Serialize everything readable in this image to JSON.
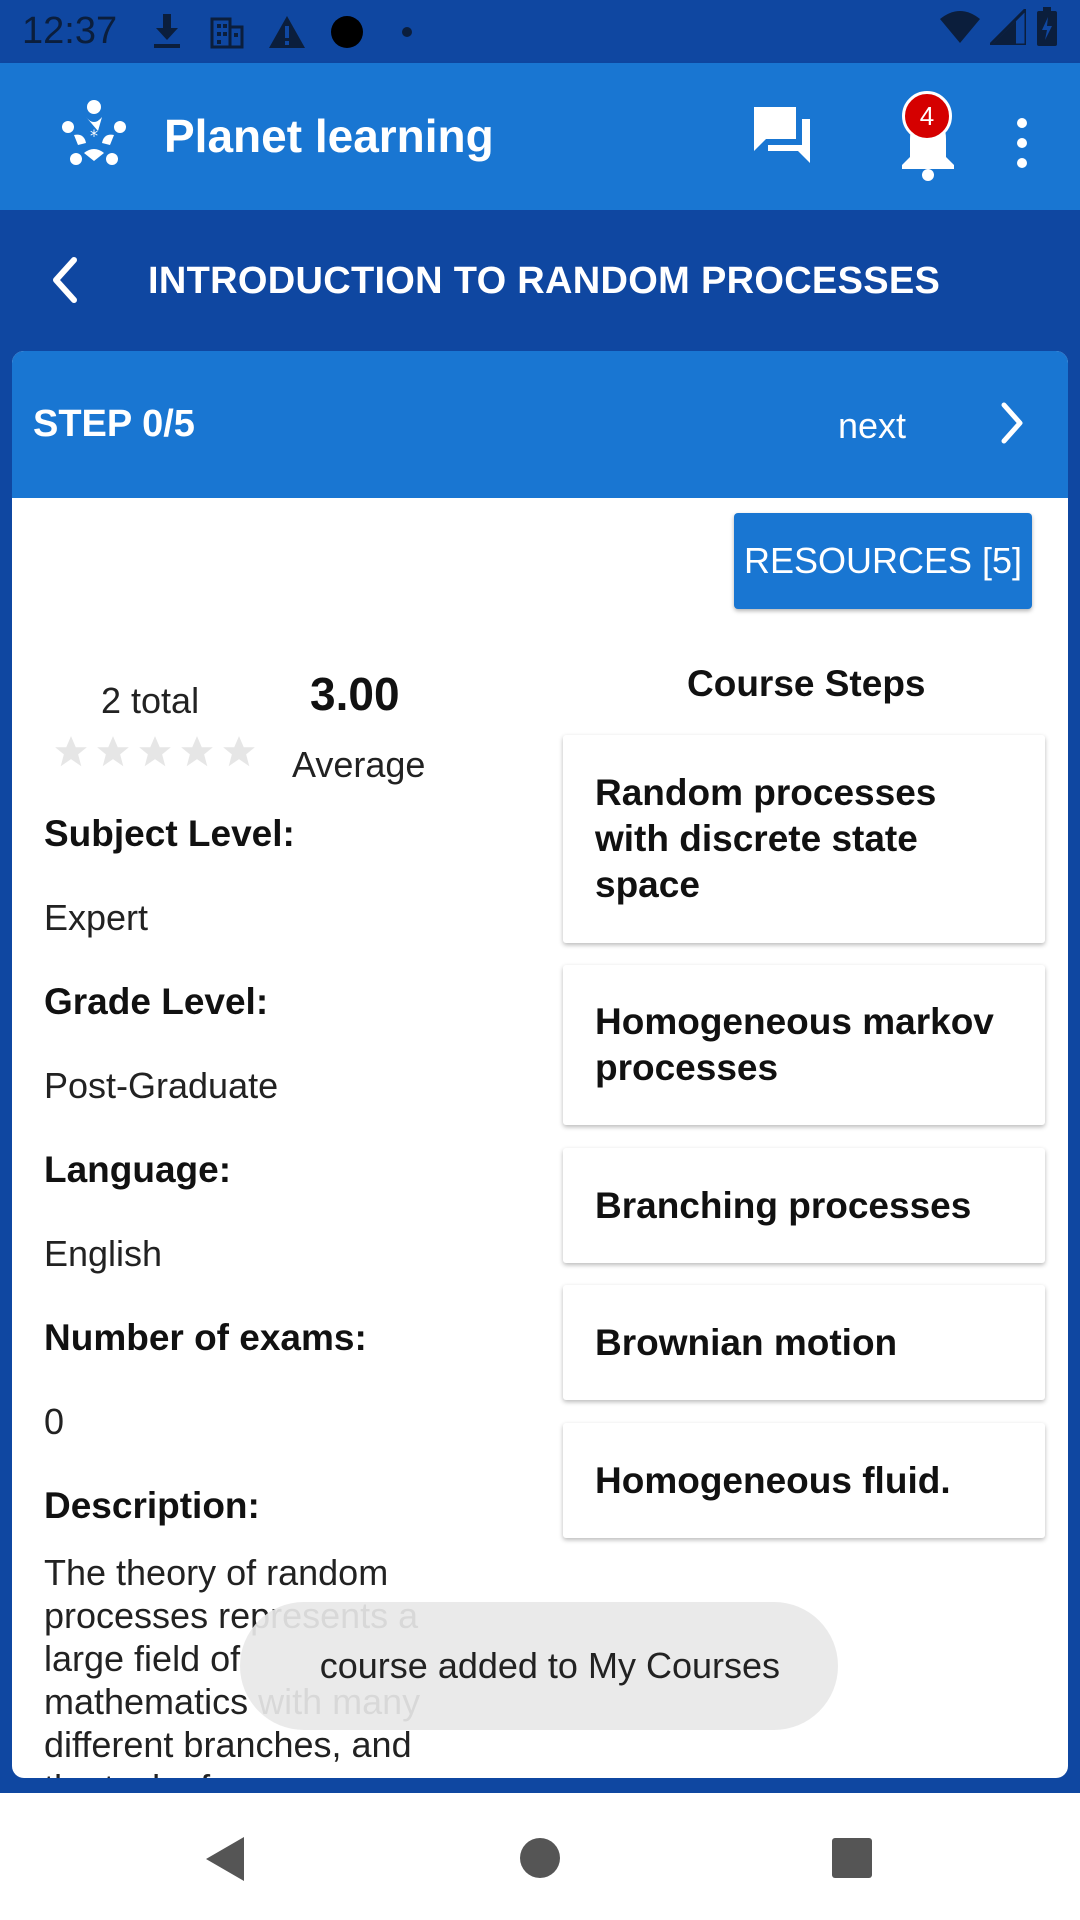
{
  "status_bar": {
    "time": "12:37",
    "icons": [
      "download-icon",
      "building-icon",
      "warning-icon",
      "circle-icon",
      "dot-icon",
      "wifi-icon",
      "signal-icon",
      "battery-icon"
    ]
  },
  "app_bar": {
    "title": "Planet learning",
    "notification_count": "4",
    "icons": [
      "logo-icon",
      "chat-icon",
      "bell-icon",
      "more-vert-icon"
    ]
  },
  "course": {
    "title": "INTRODUCTION TO RANDOM PROCESSES"
  },
  "step_bar": {
    "step": "STEP 0/5",
    "next": "next"
  },
  "resources_button": "RESOURCES [5]",
  "rating": {
    "total": "2 total",
    "average_value": "3.00",
    "average_label": "Average",
    "stars_filled": 0,
    "stars_max": 5
  },
  "details": {
    "subject_level_label": "Subject Level:",
    "subject_level": "Expert",
    "grade_level_label": "Grade Level:",
    "grade_level": "Post-Graduate",
    "language_label": "Language:",
    "language": "English",
    "exams_label": "Number of exams:",
    "exams": "0",
    "description_label": "Description:",
    "description": "The theory of random processes represents a large field of mathematics with many different branches, and the task of"
  },
  "course_steps": {
    "title": "Course Steps",
    "items": [
      "Random processes with discrete state space",
      "Homogeneous markov processes",
      "Branching processes",
      "Brownian motion",
      "Homogeneous fluid."
    ]
  },
  "toast": "course added to My Courses",
  "colors": {
    "primary": "#1976d2",
    "primary_dark": "#0f47a1",
    "badge": "#d50000"
  }
}
